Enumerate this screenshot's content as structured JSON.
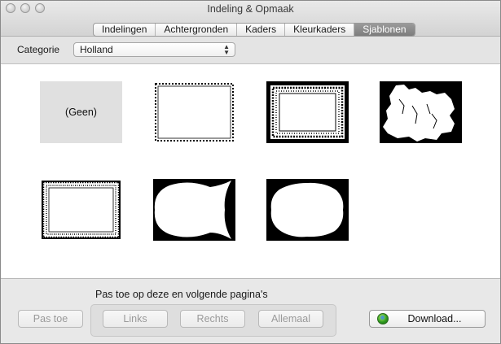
{
  "window": {
    "title": "Indeling & Opmaak"
  },
  "tabs": [
    {
      "label": "Indelingen",
      "active": false
    },
    {
      "label": "Achtergronden",
      "active": false
    },
    {
      "label": "Kaders",
      "active": false
    },
    {
      "label": "Kleurkaders",
      "active": false
    },
    {
      "label": "Sjablonen",
      "active": true
    }
  ],
  "category": {
    "label": "Categorie",
    "selected": "Holland"
  },
  "templates": [
    {
      "name": "none",
      "label": "(Geen)"
    },
    {
      "name": "zigzag-border"
    },
    {
      "name": "lace-frame-on-black"
    },
    {
      "name": "holland-map"
    },
    {
      "name": "lace-frame-white"
    },
    {
      "name": "tulip-shape"
    },
    {
      "name": "oval-shape"
    }
  ],
  "apply": {
    "label": "Pas toe op deze en volgende pagina's",
    "apply_button": "Pas toe",
    "left_button": "Links",
    "right_button": "Rechts",
    "all_button": "Allemaal"
  },
  "download": {
    "label": "Download...",
    "icon": "globe-download-icon"
  },
  "colors": {
    "active_tab": "#8a8a8a",
    "download_icon": "#2e9a1f"
  }
}
